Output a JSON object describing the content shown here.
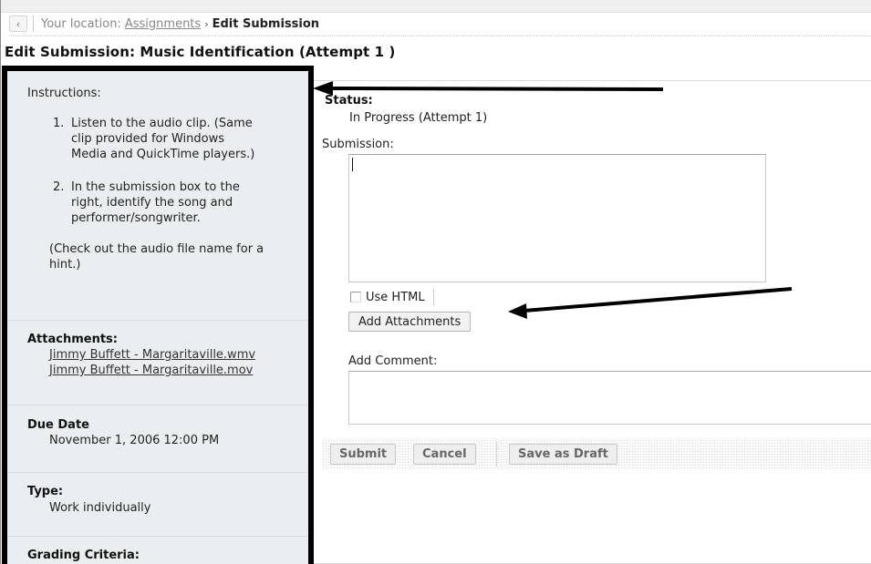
{
  "breadcrumb": {
    "back_icon": "back-arrow-icon",
    "location_label": "Your location:",
    "link": "Assignments",
    "separator": "›",
    "current": "Edit Submission"
  },
  "page_title": "Edit Submission: Music Identification (Attempt 1 )",
  "sidebar": {
    "instructions_label": "Instructions:",
    "steps": [
      {
        "num": "1.",
        "lines": [
          "Listen to the audio clip. (Same",
          "clip provided for Windows",
          "Media and QuickTime players.)"
        ]
      },
      {
        "num": "2.",
        "lines": [
          "In the submission box to the",
          "right, identify the song and",
          "performer/songwriter."
        ]
      }
    ],
    "hint_lines": [
      "(Check out the audio file name for a",
      "hint.)"
    ],
    "attachments_label": "Attachments:",
    "attachments": [
      "Jimmy Buffett - Margaritaville.wmv",
      "Jimmy Buffett - Margaritaville.mov"
    ],
    "due_date_label": "Due Date",
    "due_date": "November 1, 2006 12:00 PM",
    "type_label": "Type:",
    "type_value": "Work individually",
    "grading_label": "Grading Criteria:"
  },
  "main": {
    "status_label": "Status:",
    "status_value": "In Progress (Attempt 1)",
    "submission_label": "Submission:",
    "submission_value": "",
    "use_html_label": "Use HTML",
    "use_html_checked": false,
    "add_attachments_label": "Add Attachments",
    "comment_label": "Add Comment:",
    "comment_value": ""
  },
  "actions": {
    "submit": "Submit",
    "cancel": "Cancel",
    "save_draft": "Save as Draft"
  },
  "colors": {
    "sidebar_bg": "#eaeef1",
    "highlight_border": "#000000",
    "annotation_arrow": "#000000"
  }
}
